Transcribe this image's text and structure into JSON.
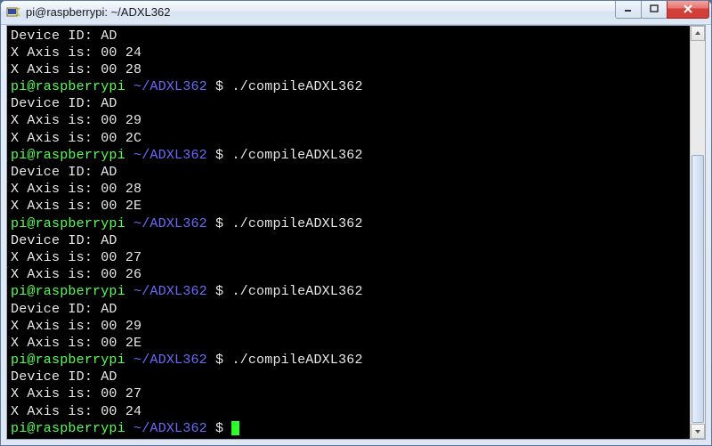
{
  "window": {
    "title": "pi@raspberrypi: ~/ADXL362"
  },
  "prompt": {
    "user_host": "pi@raspberrypi",
    "path": "~/ADXL362",
    "dollar": "$"
  },
  "terminal": {
    "runs": [
      {
        "pre_lines": [
          "Device ID: AD",
          "X Axis is: 00 24",
          "X Axis is: 00 28"
        ],
        "command": "./compileADXL362",
        "output": [
          "Device ID: AD",
          "X Axis is: 00 29",
          "X Axis is: 00 2C"
        ]
      },
      {
        "command": "./compileADXL362",
        "output": [
          "Device ID: AD",
          "X Axis is: 00 28",
          "X Axis is: 00 2E"
        ]
      },
      {
        "command": "./compileADXL362",
        "output": [
          "Device ID: AD",
          "X Axis is: 00 27",
          "X Axis is: 00 26"
        ]
      },
      {
        "command": "./compileADXL362",
        "output": [
          "Device ID: AD",
          "X Axis is: 00 29",
          "X Axis is: 00 2E"
        ]
      },
      {
        "command": "./compileADXL362",
        "output": [
          "Device ID: AD",
          "X Axis is: 00 27",
          "X Axis is: 00 24"
        ]
      }
    ]
  }
}
